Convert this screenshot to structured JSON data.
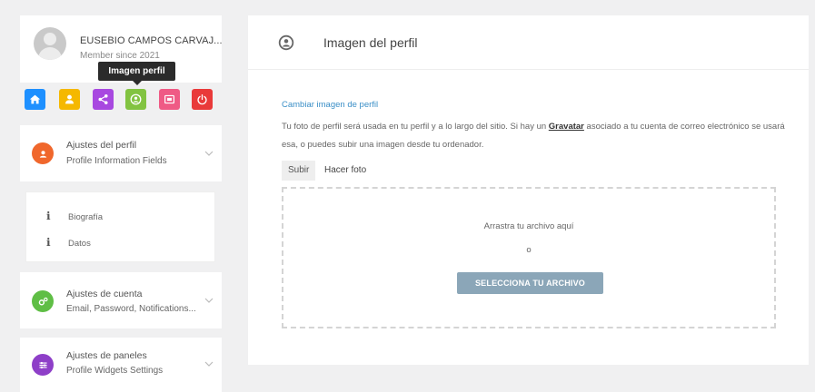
{
  "user": {
    "name": "EUSEBIO CAMPOS CARVAJ...",
    "member_since": "Member since 2021"
  },
  "tooltip": "Imagen perfil",
  "icon_buttons": [
    {
      "icon": "home-icon",
      "color": "#1e90ff"
    },
    {
      "icon": "user-icon",
      "color": "#f5b800"
    },
    {
      "icon": "share-icon",
      "color": "#a848e0"
    },
    {
      "icon": "profile-image-icon",
      "color": "#82c341"
    },
    {
      "icon": "card-icon",
      "color": "#ef5a85"
    },
    {
      "icon": "power-icon",
      "color": "#e93a3a"
    }
  ],
  "sections": {
    "profile": {
      "title": "Ajustes del perfil",
      "subtitle": "Profile Information Fields",
      "color": "#f0672c"
    },
    "profile_links": [
      "Biografía",
      "Datos"
    ],
    "account": {
      "title": "Ajustes de cuenta",
      "subtitle": "Email, Password, Notifications...",
      "color": "#5fbe45"
    },
    "widgets": {
      "title": "Ajustes de paneles",
      "subtitle": "Profile Widgets Settings",
      "color": "#8e3fc8"
    }
  },
  "main": {
    "title": "Imagen del perfil",
    "change_label": "Cambiar imagen de perfil",
    "desc_part1": "Tu foto de perfil será usada en tu perfil y a lo largo del sitio. Si hay un ",
    "gravatar_link": "Gravatar",
    "desc_part2": " asociado a tu cuenta de correo electrónico se usará esa, o puedes subir una imagen desde tu ordenador.",
    "tabs": [
      "Subir",
      "Hacer foto"
    ],
    "dropzone_text": "Arrastra tu archivo aquí",
    "dropzone_or": "o",
    "select_button": "SELECCIONA TU ARCHIVO"
  }
}
